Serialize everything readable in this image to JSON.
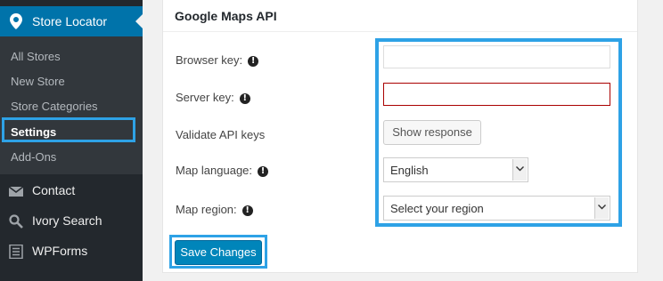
{
  "sidebar": {
    "active_menu": "Store Locator",
    "submenu": [
      "All Stores",
      "New Store",
      "Store Categories",
      "Settings",
      "Add-Ons"
    ],
    "menu_items": [
      {
        "label": "Contact",
        "icon": "envelope-icon"
      },
      {
        "label": "Ivory Search",
        "icon": "search-icon"
      },
      {
        "label": "WPForms",
        "icon": "form-icon"
      }
    ]
  },
  "panel": {
    "title": "Google Maps API",
    "browser_key_label": "Browser key:",
    "server_key_label": "Server key:",
    "validate_label": "Validate API keys",
    "show_response_button": "Show response",
    "map_language_label": "Map language:",
    "map_language_value": "English",
    "map_region_label": "Map region:",
    "map_region_value": "Select your region",
    "info_glyph": "!"
  },
  "save_button": "Save Changes",
  "colors": {
    "sidebar_bg": "#23282d",
    "active_blue": "#0073aa",
    "highlight": "#2ea2e6",
    "primary_button": "#0085ba"
  }
}
